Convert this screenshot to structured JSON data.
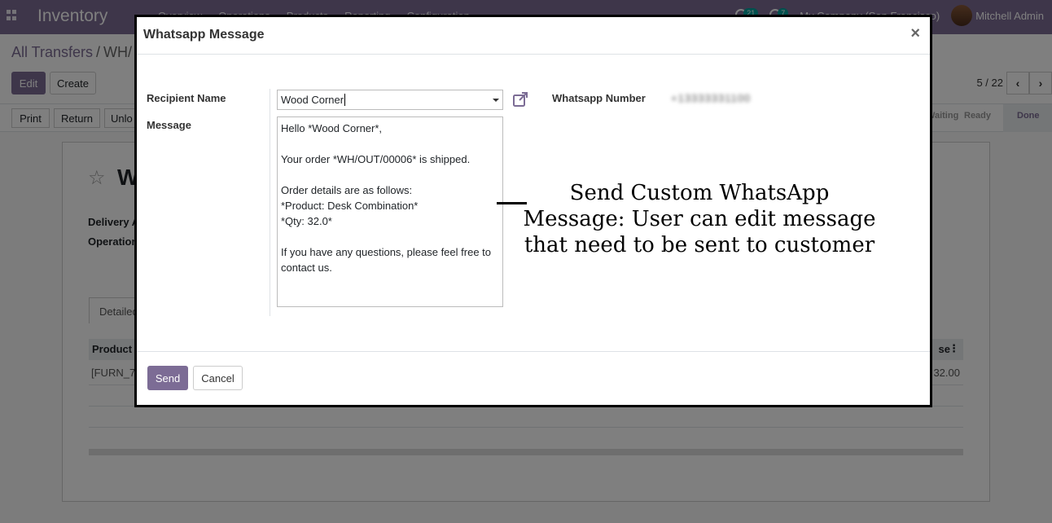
{
  "app": {
    "name": "Inventory",
    "menu": [
      "Overview",
      "Operations",
      "Products",
      "Reporting",
      "Configuration"
    ],
    "activity_count": "21",
    "message_count": "7",
    "company": "My Company (San Francisco)",
    "user": "Mitchell Admin"
  },
  "control_panel": {
    "breadcrumb_root": "All Transfers",
    "breadcrumb_separator": "/",
    "breadcrumb_current": "WH/",
    "edit_label": "Edit",
    "create_label": "Create",
    "pager": "5 / 22"
  },
  "statusbar": {
    "buttons": [
      "Print",
      "Return",
      "Unlo"
    ],
    "stages": [
      "Waiting",
      "Ready",
      "Done"
    ]
  },
  "sheet": {
    "title": "W",
    "delivery_label": "Delivery A",
    "operation_label": "Operation",
    "tab_label": "Detailed",
    "col_product": "Product",
    "col_last": "se",
    "row_product": "[FURN_7",
    "row_value": "32.00"
  },
  "modal": {
    "title": "Whatsapp Message",
    "close": "×",
    "recipient_label": "Recipient Name",
    "recipient_value": "Wood Corner",
    "whatsapp_label": "Whatsapp Number",
    "whatsapp_value": "+13333331100",
    "message_label": "Message",
    "message_value": "Hello *Wood Corner*,\n\nYour order *WH/OUT/00006* is shipped.\n\nOrder details are as follows:\n*Product: Desk Combination*\n*Qty: 32.0*\n\nIf you have any questions, please feel free to contact us.",
    "send_label": "Send",
    "cancel_label": "Cancel"
  },
  "annotation": {
    "text": "Send Custom WhatsApp Message: User can edit message that need to be sent to customer"
  },
  "colors": {
    "brand": "#7c6c95",
    "badge": "#00a09d"
  }
}
